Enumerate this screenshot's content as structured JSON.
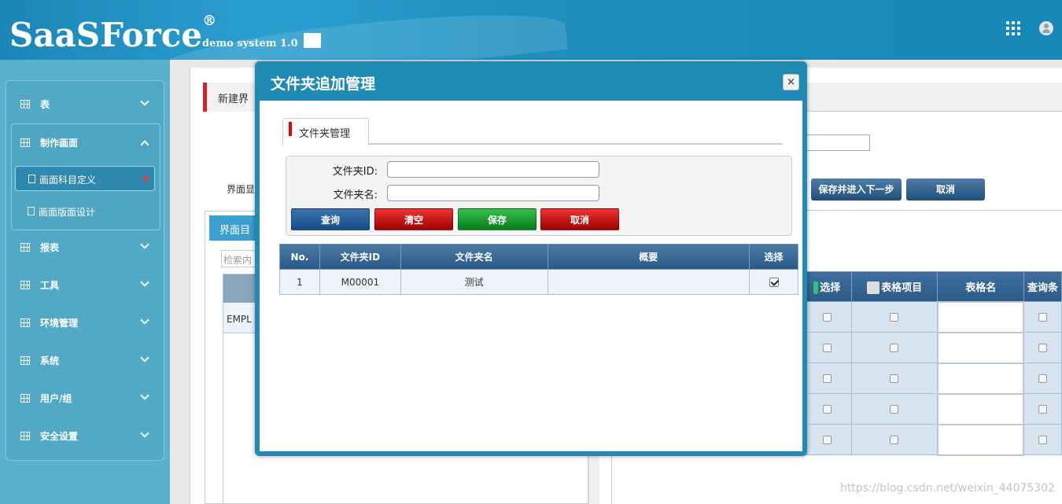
{
  "header": {
    "logo": "SaaSForce",
    "logo_mark": "®",
    "version": "demo system 1.0",
    "icons": [
      "window-icon",
      "apps-grid-icon",
      "user-avatar-icon"
    ]
  },
  "sidebar": {
    "items": [
      {
        "label": "表",
        "icon": "table-icon"
      },
      {
        "label": "制作画面",
        "icon": "table-icon",
        "expanded": true,
        "children": [
          {
            "label": "画面科目定义",
            "active": true
          },
          {
            "label": "画面版面设计"
          }
        ]
      },
      {
        "label": "报表",
        "icon": "table-icon"
      },
      {
        "label": "工具",
        "icon": "table-icon"
      },
      {
        "label": "环境管理",
        "icon": "table-icon"
      },
      {
        "label": "系统",
        "icon": "table-icon"
      },
      {
        "label": "用户/组",
        "icon": "table-icon"
      },
      {
        "label": "安全设置",
        "icon": "table-icon"
      }
    ]
  },
  "background": {
    "tab_label": "新建界",
    "form_label": "界面显",
    "left_tab": "界面目",
    "search_placeholder": "检索内",
    "left_cell": "EMPL",
    "buttons": {
      "save_next": "保存并进入下一步",
      "cancel": "取消"
    },
    "table": {
      "headers": [
        "选择",
        "表格项目",
        "表格名",
        "查询条"
      ],
      "row_count": 5
    }
  },
  "modal": {
    "title": "文件夹追加管理",
    "close": "×",
    "tab": "文件夹管理",
    "form": {
      "folder_id_label": "文件夹ID:",
      "folder_id_value": "",
      "folder_name_label": "文件夹名:",
      "folder_name_value": ""
    },
    "buttons": {
      "query": "查询",
      "clear": "清空",
      "save": "保存",
      "cancel": "取消"
    },
    "table": {
      "headers": [
        "No.",
        "文件夹ID",
        "文件夹名",
        "概要",
        "选择"
      ],
      "rows": [
        {
          "no": "1",
          "id": "M00001",
          "name": "测试",
          "summary": "",
          "selected": true
        }
      ]
    }
  },
  "watermark": "https://blog.csdn.net/weixin_44075302",
  "colors": {
    "header": "#1f8bb5",
    "sidebar": "#52a9c6",
    "accent_red": "#d8202a"
  }
}
